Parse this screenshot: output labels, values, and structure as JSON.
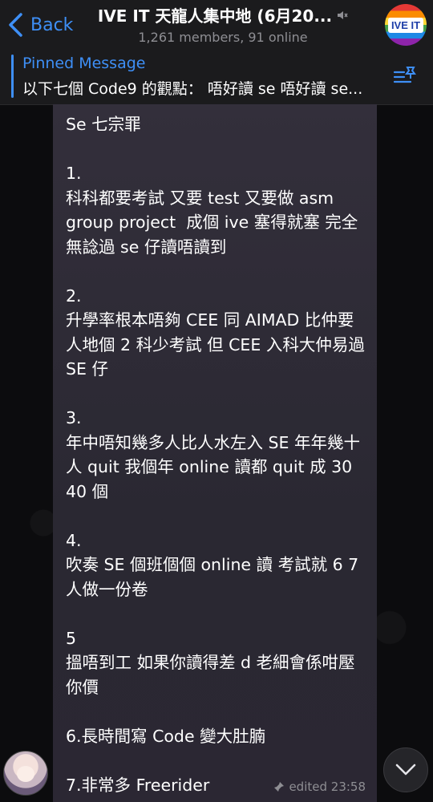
{
  "header": {
    "back_label": "Back",
    "title": "IVE IT 天龍人集中地 (6月20...",
    "subtitle": "1,261 members, 91 online",
    "group_avatar_text": "IVE IT",
    "mute_icon": "speaker-mute-icon"
  },
  "pinned": {
    "label": "Pinned Message",
    "text": "以下七個 Code9 的觀點： 唔好讀 se 唔好讀 se..."
  },
  "message": {
    "text": "Se 七宗罪\n\n1.\n科科都要考試 又要 test 又要做 asm group project  成個 ive 塞得就塞 完全無諗過 se 仔讀唔讀到\n\n2.\n升學率根本唔夠 CEE 同 AIMAD 比仲要人地個 2 科少考試 但 CEE 入科大仲易過 SE 仔\n\n3.\n年中唔知幾多人比人水左入 SE 年年幾十人 quit 我個年 online 讀都 quit 成 30 40 個\n\n4.\n吹奏 SE 個班個個 online 讀 考試就 6 7 人做一份卷\n\n5\n搵唔到工 如果你讀得差 d 老細會係咁壓你價\n\n6.長時間寫 Code 變大肚腩\n\n7.非常多 Freerider",
    "status": "edited 23:58"
  },
  "colors": {
    "accent": "#3e8ff6",
    "header_bg": "#1b1b1d",
    "bubble_bg": "#2f2c37",
    "meta_text": "#8e8e93"
  }
}
